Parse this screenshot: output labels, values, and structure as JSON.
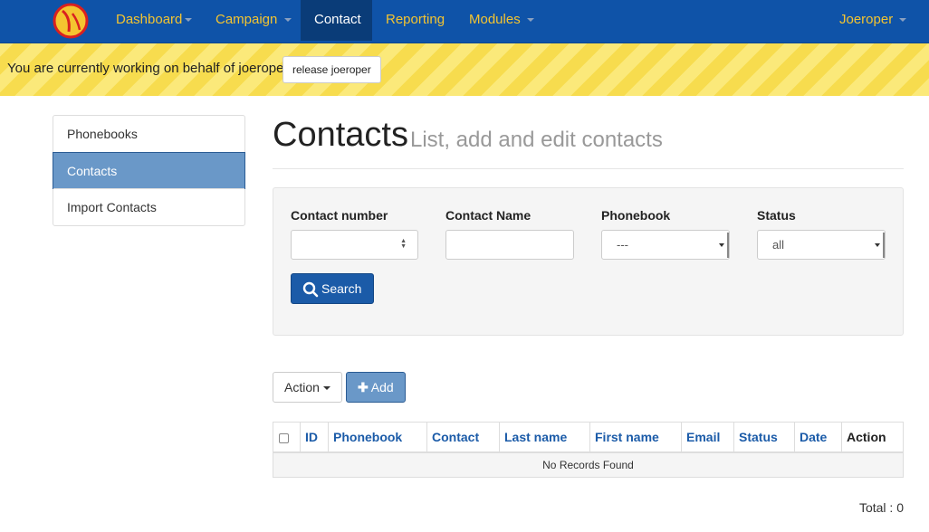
{
  "navbar": {
    "brand_colors": {
      "background": "#0f53a8",
      "link": "#f4c430",
      "active": "#0a3c78"
    },
    "items": [
      {
        "label": "Dashboard",
        "has_caret": true
      },
      {
        "label": "Campaign",
        "has_caret": true
      },
      {
        "label": "Contact",
        "active": true
      },
      {
        "label": "Reporting"
      },
      {
        "label": "Modules",
        "has_caret": true
      }
    ],
    "user": {
      "label": "Joeroper"
    }
  },
  "banner": {
    "text": "You are currently working on behalf of joeroper.",
    "release_button": "release joeroper"
  },
  "sidebar": {
    "items": [
      {
        "label": "Phonebooks"
      },
      {
        "label": "Contacts",
        "active": true
      },
      {
        "label": "Import Contacts"
      }
    ]
  },
  "header": {
    "title": "Contacts",
    "subtitle": "List, add and edit contacts"
  },
  "filters": {
    "contact_number": {
      "label": "Contact number",
      "value": ""
    },
    "contact_name": {
      "label": "Contact Name",
      "value": ""
    },
    "phonebook": {
      "label": "Phonebook",
      "selected": "---"
    },
    "status": {
      "label": "Status",
      "selected": "all"
    },
    "search_button": "Search"
  },
  "toolbar": {
    "action_label": "Action",
    "add_label": "Add"
  },
  "table": {
    "columns": [
      "ID",
      "Phonebook",
      "Contact",
      "Last name",
      "First name",
      "Email",
      "Status",
      "Date",
      "Action"
    ],
    "empty_message": "No Records Found",
    "total": "Total : 0"
  }
}
